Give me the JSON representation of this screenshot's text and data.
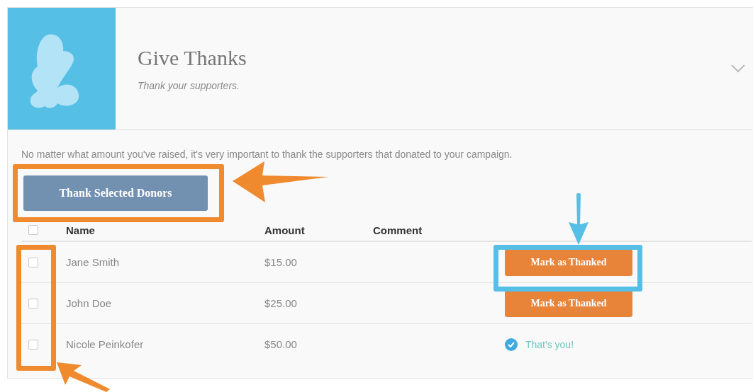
{
  "header": {
    "title": "Give Thanks",
    "subtitle": "Thank your supporters.",
    "expanded": false
  },
  "description": "No matter what amount you've raised, it's very important to thank the supporters that donated to your campaign.",
  "thank_button": "Thank Selected Donors",
  "table": {
    "select_all": {
      "checked": false
    },
    "columns": [
      "Name",
      "Amount",
      "Comment"
    ],
    "rows": [
      {
        "name": "Jane Smith",
        "amount": "$15.00",
        "checked": false,
        "action": {
          "kind": "button",
          "label": "Mark as Thanked"
        }
      },
      {
        "name": "John Doe",
        "amount": "$25.00",
        "checked": false,
        "action": {
          "kind": "button",
          "label": "Mark as Thanked"
        }
      },
      {
        "name": "Nicole Peinkofer",
        "amount": "$50.00",
        "checked": false,
        "action": {
          "kind": "status",
          "label": "That's you!"
        }
      }
    ]
  }
}
